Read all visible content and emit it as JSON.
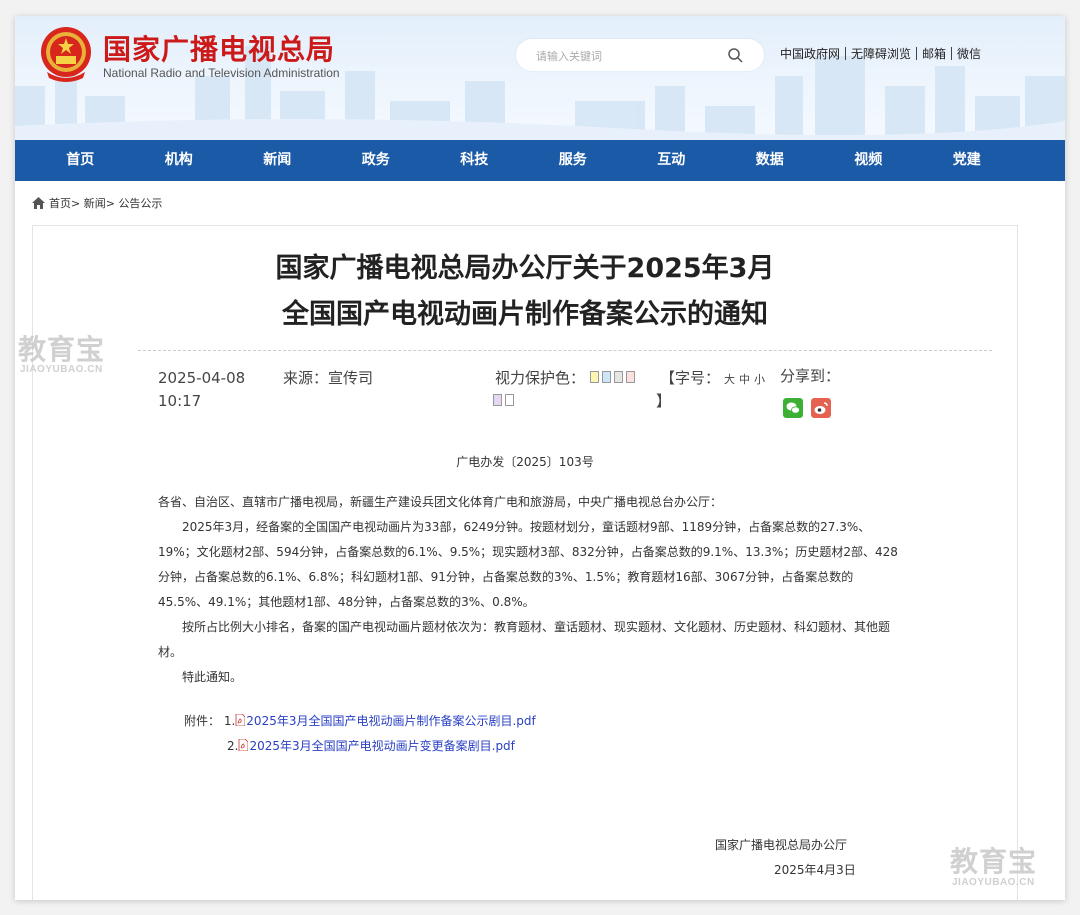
{
  "header": {
    "site_title": "国家广播电视总局",
    "site_subtitle": "National Radio and Television Administration",
    "search_placeholder": "请输入关键词",
    "top_links": [
      "中国政府网",
      "无障碍浏览",
      "邮箱",
      "微信"
    ]
  },
  "nav": {
    "items": [
      "首页",
      "机构",
      "新闻",
      "政务",
      "科技",
      "服务",
      "互动",
      "数据",
      "视频",
      "党建"
    ]
  },
  "breadcrumb": {
    "items": [
      "首页>",
      "新闻>",
      "公告公示"
    ]
  },
  "article": {
    "title_line1": "国家广播电视总局办公厅关于2025年3月",
    "title_line2": "全国国产电视动画片制作备案公示的通知",
    "date": "2025-04-08 10:17",
    "source": "来源：宣传司",
    "eye_protect_label": "视力保护色：",
    "font_size_label": "【字号：",
    "font_sizes": [
      "大",
      "中",
      "小"
    ],
    "bracket_close": "】",
    "share_label": "分享到：",
    "doc_number": "广电办发〔2025〕103号",
    "salutation": "各省、自治区、直辖市广播电视局，新疆生产建设兵团文化体育广电和旅游局，中央广播电视总台办公厅：",
    "paragraph1": "2025年3月，经备案的全国国产电视动画片为33部，6249分钟。按题材划分，童话题材9部、1189分钟，占备案总数的27.3%、19%；文化题材2部、594分钟，占备案总数的6.1%、9.5%；现实题材3部、832分钟，占备案总数的9.1%、13.3%；历史题材2部、428分钟，占备案总数的6.1%、6.8%；科幻题材1部、91分钟，占备案总数的3%、1.5%；教育题材16部、3067分钟，占备案总数的45.5%、49.1%；其他题材1部、48分钟，占备案总数的3%、0.8%。",
    "paragraph2": "按所占比例大小排名，备案的国产电视动画片题材依次为：教育题材、童话题材、现实题材、文化题材、历史题材、科幻题材、其他题材。",
    "paragraph3": "特此通知。",
    "attachment_label": "附件：",
    "attachment1_index": "1.",
    "attachment1_link": "2025年3月全国国产电视动画片制作备案公示剧目.pdf",
    "attachment2_index": "2.",
    "attachment2_link": "2025年3月全国国产电视动画片变更备案剧目.pdf",
    "signature_org": "国家广播电视总局办公厅",
    "signature_date": "2025年4月3日"
  },
  "watermark": {
    "text": "教育宝",
    "domain": "JIAOYUBAO.CN"
  },
  "colors": {
    "title_red": "#cc1a1a",
    "nav_blue": "#1b5aa6",
    "link_blue": "#2a40c4",
    "eye_swatches": [
      "#fdf6b2",
      "#cde6f7",
      "#e6e6e6",
      "#fbe0e0",
      "#e6d8f5",
      "#ffffff"
    ]
  }
}
